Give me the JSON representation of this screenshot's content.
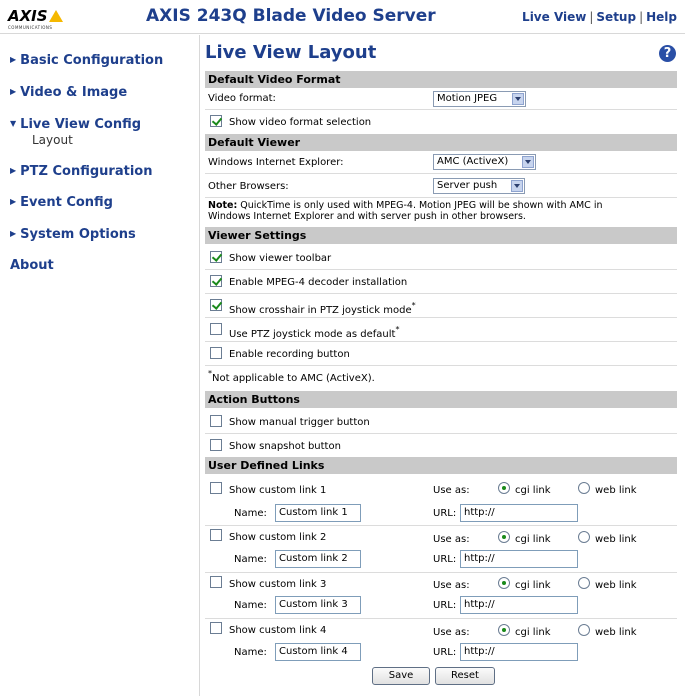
{
  "header": {
    "logo_text": "AXIS",
    "logo_sub": "COMMUNICATIONS",
    "product_title": "AXIS 243Q Blade Video Server",
    "links": {
      "live_view": "Live View",
      "separator": "|",
      "setup": "Setup",
      "help": "Help"
    }
  },
  "sidebar": {
    "items": [
      {
        "label": "Basic Configuration",
        "arrow": "▶"
      },
      {
        "label": "Video & Image",
        "arrow": "▶"
      },
      {
        "label": "Live View Config",
        "arrow": "▼"
      },
      {
        "label": "PTZ Configuration",
        "arrow": "▶"
      },
      {
        "label": "Event Config",
        "arrow": "▶"
      },
      {
        "label": "System Options",
        "arrow": "▶"
      },
      {
        "label": "About",
        "arrow": ""
      }
    ],
    "sub_item": "Layout"
  },
  "page": {
    "title": "Live View Layout",
    "help_icon": "?"
  },
  "default_video_format": {
    "heading": "Default Video Format",
    "label": "Video format:",
    "value": "Motion JPEG",
    "show_selection_label": "Show video format selection",
    "show_selection_checked": true
  },
  "default_viewer": {
    "heading": "Default Viewer",
    "ie_label": "Windows Internet Explorer:",
    "ie_value": "AMC (ActiveX)",
    "other_label": "Other Browsers:",
    "other_value": "Server push",
    "note_bold": "Note:",
    "note_line1": " QuickTime is only used with MPEG-4. Motion JPEG will be shown with AMC in",
    "note_line2": "Windows Internet Explorer and with server push in other browsers."
  },
  "viewer_settings": {
    "heading": "Viewer Settings",
    "options": [
      {
        "label": "Show viewer toolbar",
        "checked": true,
        "star": ""
      },
      {
        "label": "Enable MPEG-4 decoder installation",
        "checked": true,
        "star": ""
      },
      {
        "label": "Show crosshair in PTZ joystick mode",
        "checked": true,
        "star": "*"
      },
      {
        "label": "Use PTZ joystick mode as default",
        "checked": false,
        "star": "*"
      },
      {
        "label": "Enable recording button",
        "checked": false,
        "star": ""
      }
    ],
    "footnote_star": "*",
    "footnote": "Not applicable to AMC (ActiveX)."
  },
  "action_buttons": {
    "heading": "Action Buttons",
    "options": [
      {
        "label": "Show manual trigger button",
        "checked": false
      },
      {
        "label": "Show snapshot button",
        "checked": false
      }
    ]
  },
  "user_links": {
    "heading": "User Defined Links",
    "use_as_label": "Use as:",
    "cgi_label": "cgi link",
    "web_label": "web link",
    "name_label": "Name:",
    "url_label": "URL:",
    "links": [
      {
        "show_label": "Show custom link 1",
        "checked": false,
        "name": "Custom link 1",
        "url": "http://",
        "use_as": "cgi"
      },
      {
        "show_label": "Show custom link 2",
        "checked": false,
        "name": "Custom link 2",
        "url": "http://",
        "use_as": "cgi"
      },
      {
        "show_label": "Show custom link 3",
        "checked": false,
        "name": "Custom link 3",
        "url": "http://",
        "use_as": "cgi"
      },
      {
        "show_label": "Show custom link 4",
        "checked": false,
        "name": "Custom link 4",
        "url": "http://",
        "use_as": "cgi"
      }
    ]
  },
  "footer": {
    "save": "Save",
    "reset": "Reset"
  },
  "colors": {
    "accent": "#1e3f8c",
    "section_bar": "#c9c9c9",
    "check": "#1a8a1a",
    "logo_yellow": "#f5b800"
  }
}
